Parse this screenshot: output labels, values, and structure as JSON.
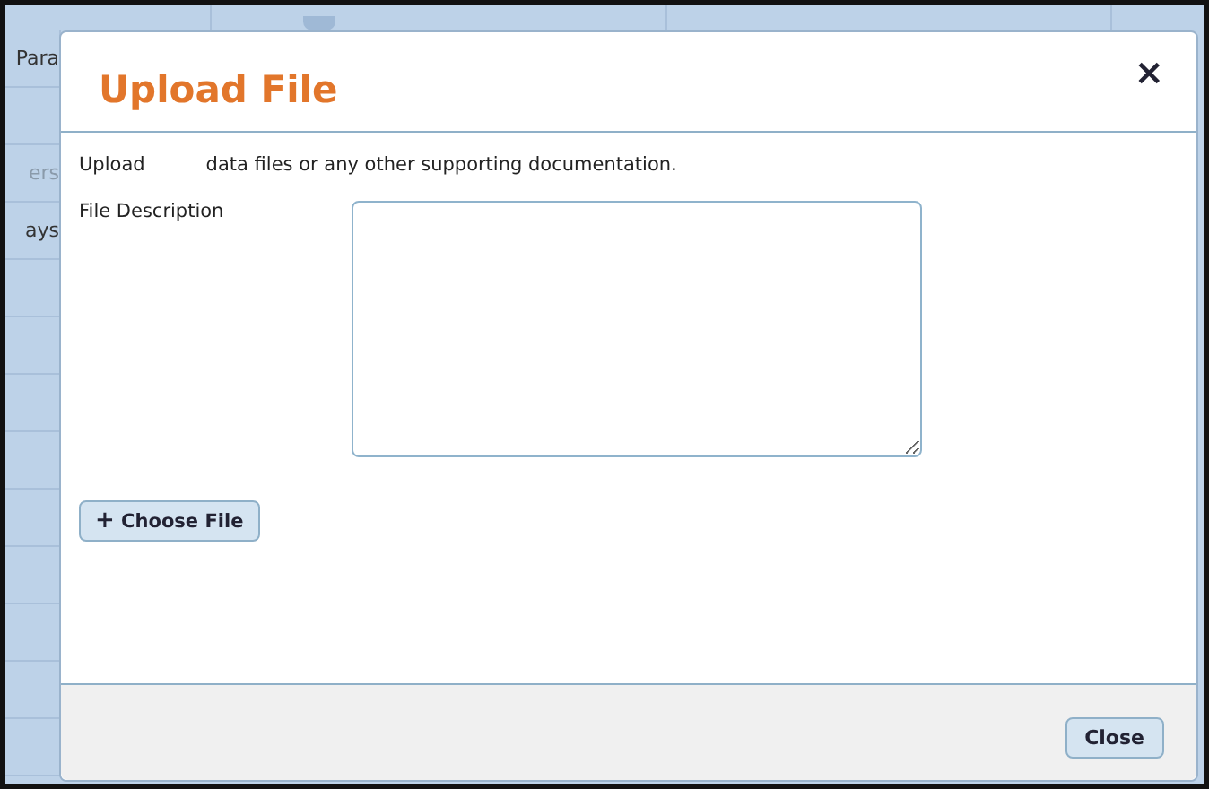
{
  "background": {
    "row_labels": [
      {
        "text": "Para",
        "disabled": false
      },
      {
        "text": "ers",
        "disabled": true
      },
      {
        "text": "ays",
        "disabled": false
      }
    ]
  },
  "dialog": {
    "title": "Upload File",
    "close_icon": "×",
    "intro": [
      "Upload",
      "data files or any other supporting documentation."
    ],
    "description_label": "File Description",
    "choose_button": {
      "icon": "+",
      "label": "Choose File"
    },
    "footer_buttons": [
      "Close"
    ]
  }
}
